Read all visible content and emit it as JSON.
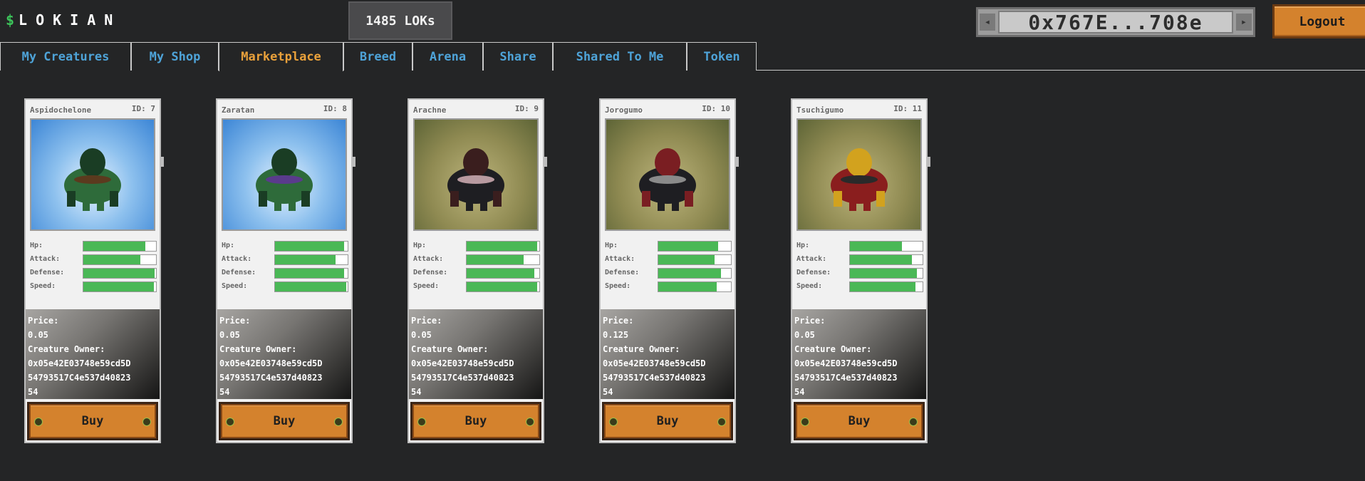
{
  "app": {
    "logo_symbol": "$",
    "logo_text": "LOKIAN"
  },
  "header": {
    "token_balance": "1485 LOKs",
    "wallet_address": "0x767E...708e",
    "logout_label": "Logout"
  },
  "tabs": [
    {
      "label": "My Creatures",
      "active": false
    },
    {
      "label": "My Shop",
      "active": false
    },
    {
      "label": "Marketplace",
      "active": true
    },
    {
      "label": "Breed",
      "active": false
    },
    {
      "label": "Arena",
      "active": false
    },
    {
      "label": "Share",
      "active": false
    },
    {
      "label": "Shared To Me",
      "active": false
    },
    {
      "label": "Token",
      "active": false
    }
  ],
  "labels": {
    "hp": "Hp:",
    "attack": "Attack:",
    "defense": "Defense:",
    "speed": "Speed:",
    "price": "Price:",
    "owner": "Creature Owner:",
    "buy": "Buy"
  },
  "cards": [
    {
      "name": "Aspidochelone",
      "id": "ID: 7",
      "habitat": "water",
      "stats": {
        "hp": 0.85,
        "attack": 0.78,
        "defense": 0.98,
        "speed": 0.97
      },
      "price": "0.05",
      "owner_lines": [
        "0x05e42E03748e59cd5D",
        "54793517C4e537d40823",
        "54"
      ]
    },
    {
      "name": "Zaratan",
      "id": "ID: 8",
      "habitat": "water",
      "stats": {
        "hp": 0.95,
        "attack": 0.83,
        "defense": 0.95,
        "speed": 0.98
      },
      "price": "0.05",
      "owner_lines": [
        "0x05e42E03748e59cd5D",
        "54793517C4e537d40823",
        "54"
      ]
    },
    {
      "name": "Arachne",
      "id": "ID: 9",
      "habitat": "ground",
      "stats": {
        "hp": 0.97,
        "attack": 0.78,
        "defense": 0.93,
        "speed": 0.97
      },
      "price": "0.05",
      "owner_lines": [
        "0x05e42E03748e59cd5D",
        "54793517C4e537d40823",
        "54"
      ]
    },
    {
      "name": "Jorogumo",
      "id": "ID: 10",
      "habitat": "ground",
      "stats": {
        "hp": 0.82,
        "attack": 0.77,
        "defense": 0.86,
        "speed": 0.8
      },
      "price": "0.125",
      "owner_lines": [
        "0x05e42E03748e59cd5D",
        "54793517C4e537d40823",
        "54"
      ]
    },
    {
      "name": "Tsuchigumo",
      "id": "ID: 11",
      "habitat": "ground",
      "stats": {
        "hp": 0.72,
        "attack": 0.85,
        "defense": 0.92,
        "speed": 0.9
      },
      "price": "0.05",
      "owner_lines": [
        "0x05e42E03748e59cd5D",
        "54793517C4e537d40823",
        "54"
      ]
    }
  ]
}
